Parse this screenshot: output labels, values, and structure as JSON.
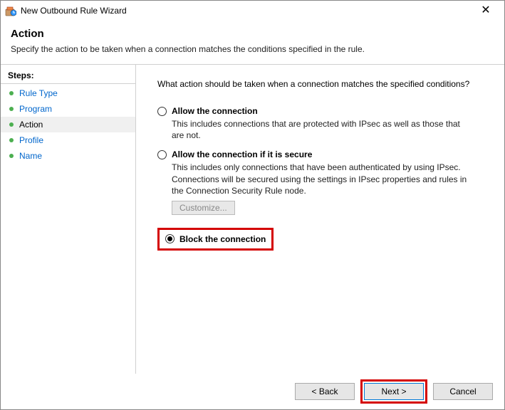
{
  "window": {
    "title": "New Outbound Rule Wizard"
  },
  "header": {
    "title": "Action",
    "subtitle": "Specify the action to be taken when a connection matches the conditions specified in the rule."
  },
  "sidebar": {
    "label": "Steps:",
    "items": [
      {
        "label": "Rule Type",
        "active": false
      },
      {
        "label": "Program",
        "active": false
      },
      {
        "label": "Action",
        "active": true
      },
      {
        "label": "Profile",
        "active": false
      },
      {
        "label": "Name",
        "active": false
      }
    ]
  },
  "main": {
    "prompt": "What action should be taken when a connection matches the specified conditions?",
    "options": {
      "allow": {
        "label": "Allow the connection",
        "desc": "This includes connections that are protected with IPsec as well as those that are not."
      },
      "allow_secure": {
        "label": "Allow the connection if it is secure",
        "desc": "This includes only connections that have been authenticated by using IPsec.  Connections will be secured using the settings in IPsec properties and rules in the Connection Security Rule node.",
        "customize": "Customize..."
      },
      "block": {
        "label": "Block the connection"
      }
    }
  },
  "footer": {
    "back": "< Back",
    "next": "Next >",
    "cancel": "Cancel"
  }
}
